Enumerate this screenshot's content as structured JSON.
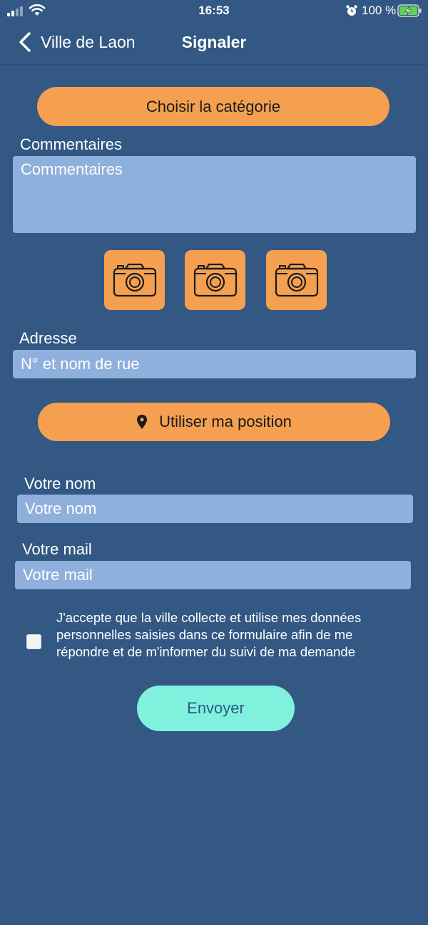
{
  "status_bar": {
    "time": "16:53",
    "battery_percent": "100 %",
    "signal_icon": "cellular-signal-icon",
    "wifi_icon": "wifi-icon",
    "alarm_icon": "alarm-clock-icon",
    "battery_icon": "battery-charging-icon",
    "battery_level": 1.0
  },
  "nav": {
    "back_label": "Ville de Laon",
    "title": "Signaler",
    "back_icon": "chevron-left-icon"
  },
  "form": {
    "category_button": "Choisir la catégorie",
    "comments_label": "Commentaires",
    "comments_placeholder": "Commentaires",
    "photo_icon": "camera-icon",
    "address_label": "Adresse",
    "address_placeholder": "N° et nom de rue",
    "position_button": "Utiliser ma position",
    "position_icon": "map-pin-icon",
    "name_label": "Votre nom",
    "name_placeholder": "Votre nom",
    "mail_label": "Votre mail",
    "mail_placeholder": "Votre mail",
    "consent_text": "J'accepte que la ville collecte et utilise mes données personnelles saisies dans ce formulaire afin de me répondre et de m'informer du suivi de ma demande",
    "consent_checked": false,
    "submit_button": "Envoyer"
  },
  "colors": {
    "background": "#325883",
    "accent_orange": "#f4a050",
    "field_blue": "#8fafdc",
    "submit_mint": "#7ff1dd",
    "submit_text": "#2d5a86"
  }
}
